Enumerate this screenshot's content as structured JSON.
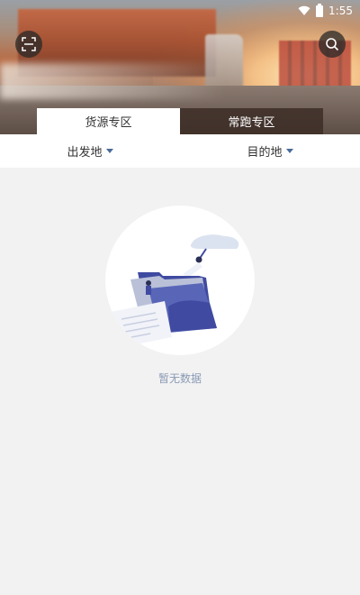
{
  "status_bar": {
    "time": "1:55"
  },
  "header": {
    "scan_icon": "scan-icon",
    "search_icon": "search-icon"
  },
  "tabs": [
    {
      "label": "货源专区",
      "active": true
    },
    {
      "label": "常跑专区",
      "active": false
    }
  ],
  "filters": {
    "origin": "出发地",
    "destination": "目的地"
  },
  "empty_state": {
    "message": "暂无数据",
    "illustration": "empty-folder-illustration"
  },
  "colors": {
    "accent": "#4a6b9a",
    "illustration_blue": "#3f4aa0",
    "background": "#f2f2f2"
  }
}
